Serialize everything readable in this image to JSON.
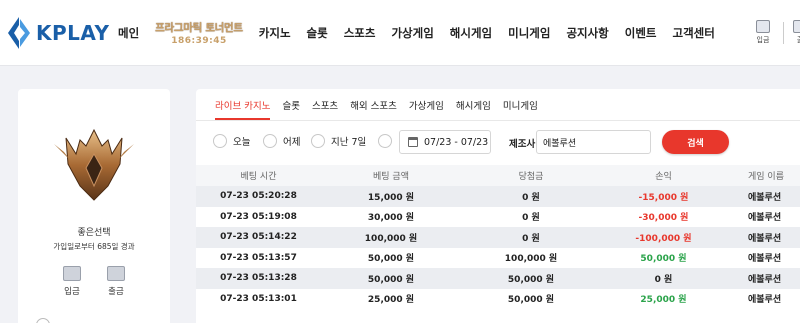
{
  "logo": {
    "text": "KPLAY"
  },
  "nav": {
    "items": [
      "메인",
      "카지노",
      "슬롯",
      "스포츠",
      "가상게임",
      "해시게임",
      "미니게임",
      "공지사항",
      "이벤트",
      "고객센터"
    ],
    "promo": {
      "title": "프라그마틱 토너먼트",
      "countdown": "186:39:45"
    },
    "deposit_label": "입금",
    "withdraw_label": "출"
  },
  "profile": {
    "username": "좋은선택",
    "join_info": "가입일로부터 685일 경과",
    "deposit_label": "입금",
    "withdraw_label": "출금"
  },
  "tabs": [
    "라이브 카지노",
    "슬롯",
    "스포츠",
    "해외 스포츠",
    "가상게임",
    "해시게임",
    "미니게임"
  ],
  "active_tab": 0,
  "filters": {
    "today": "오늘",
    "yesterday": "어제",
    "last7": "지난 7일",
    "date_range": "07/23 - 07/23",
    "maker_label": "제조사:",
    "maker_value": "에볼루션",
    "search_label": "검색"
  },
  "table": {
    "headers": [
      "베팅 시간",
      "베팅 금액",
      "당첨금",
      "손익",
      "게임 이름"
    ],
    "rows": [
      {
        "time": "07-23 05:20:28",
        "bet": "15,000 원",
        "win": "0 원",
        "pnl": "-15,000 원",
        "pnl_type": "neg",
        "game": "에볼루션"
      },
      {
        "time": "07-23 05:19:08",
        "bet": "30,000 원",
        "win": "0 원",
        "pnl": "-30,000 원",
        "pnl_type": "neg",
        "game": "에볼루션"
      },
      {
        "time": "07-23 05:14:22",
        "bet": "100,000 원",
        "win": "0 원",
        "pnl": "-100,000 원",
        "pnl_type": "neg",
        "game": "에볼루션"
      },
      {
        "time": "07-23 05:13:57",
        "bet": "50,000 원",
        "win": "100,000 원",
        "pnl": "50,000 원",
        "pnl_type": "pos",
        "game": "에볼루션"
      },
      {
        "time": "07-23 05:13:28",
        "bet": "50,000 원",
        "win": "50,000 원",
        "pnl": "0 원",
        "pnl_type": "zero",
        "game": "에볼루션"
      },
      {
        "time": "07-23 05:13:01",
        "bet": "25,000 원",
        "win": "50,000 원",
        "pnl": "25,000 원",
        "pnl_type": "pos",
        "game": "에볼루션"
      }
    ]
  },
  "colors": {
    "accent": "#e8372c",
    "brand": "#1a5fa8",
    "positive": "#2aa34a"
  }
}
